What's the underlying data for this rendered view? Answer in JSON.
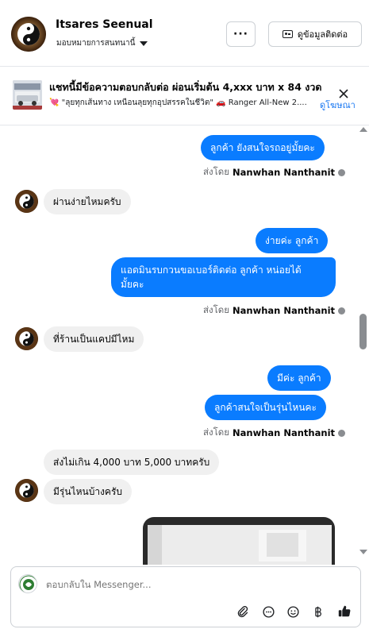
{
  "header": {
    "contact_name": "Itsares Seenual",
    "assign_label": "มอบหมายการสนทนานี้",
    "more_label": "···",
    "contact_info_label": "ดูข้อมูลติดต่อ"
  },
  "ad": {
    "title": "แชทนี้มีข้อความตอบกลับต่อ ผ่อนเริ่มต้น 4,xxx บาท x 84 งวด",
    "subtitle": "💘 \"ลุยทุกเส้นทาง เหนือนลุยทุกอุปสรรคในชีวิต\" 🚗 Ranger All-New 2....",
    "link_label": "ดูโฆษณา"
  },
  "messages": [
    {
      "side": "out",
      "text": "ลูกค้า ยังสนใจรถอยู่มั้ยคะ"
    },
    {
      "side": "meta",
      "prefix": "ส่งโดย",
      "name": "Nanwhan Nanthanit"
    },
    {
      "side": "in",
      "text": "ผ่านง่ายไหมครับ"
    },
    {
      "side": "out",
      "text": "ง่ายค่ะ  ลูกค้า"
    },
    {
      "side": "out",
      "text": "แอดมินรบกวนขอเบอร์ติดต่อ ลูกค้า หน่อยได้",
      "text2": "มั้ยคะ"
    },
    {
      "side": "meta",
      "prefix": "ส่งโดย",
      "name": "Nanwhan Nanthanit"
    },
    {
      "side": "in",
      "text": "ที่ร้านเป็นแคปมีไหม"
    },
    {
      "side": "out",
      "text": "มีค่ะ  ลูกค้า"
    },
    {
      "side": "out",
      "text": "ลูกค้าสนใจเป็นรุ่นไหนคะ"
    },
    {
      "side": "meta",
      "prefix": "ส่งโดย",
      "name": "Nanwhan Nanthanit"
    },
    {
      "side": "in",
      "text": "ส่งไม่เกิน 4,000 บาท 5,000 บาทครับ"
    },
    {
      "side": "in",
      "text": "มีรุ่นไหนบ้างครับ"
    }
  ],
  "composer": {
    "placeholder": "ตอบกลับใน Messenger..."
  },
  "icons": {
    "attach": "paperclip-icon",
    "emoji_comment": "comment-icon",
    "emoji": "smiley-icon",
    "currency": "baht-icon",
    "like": "thumbs-up-icon"
  },
  "colors": {
    "accent": "#0a7cff",
    "incoming": "#f0f0f0",
    "link": "#1877f2"
  }
}
